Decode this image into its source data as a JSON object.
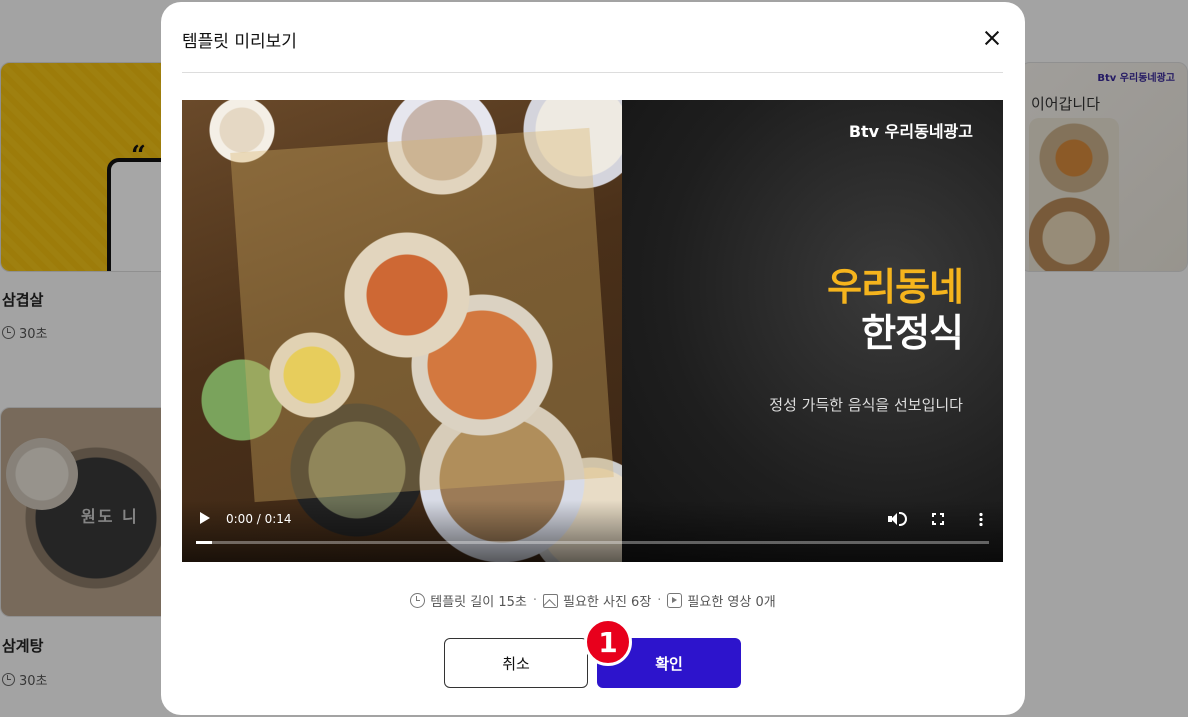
{
  "background": {
    "cards": [
      {
        "title": "삼겹살",
        "duration": "30초"
      },
      {
        "title": "삼계탕",
        "duration": "30초"
      }
    ],
    "right_card": {
      "brand": "Btv 우리동네광고",
      "text": "이어갑니다"
    },
    "soup_card_brand": "원도 니"
  },
  "modal": {
    "title": "템플릿 미리보기",
    "close_icon": "close-icon",
    "video": {
      "brand": "Btv 우리동네광고",
      "headline_line1": "우리동네",
      "headline_line2": "한정식",
      "subtitle": "정성 가득한 음식을 선보입니다",
      "time": "0:00 / 0:14",
      "progress": 0.02,
      "accent": "#f5b41d"
    },
    "meta": {
      "length": "템플릿 길이 15초",
      "photos": "필요한 사진 6장",
      "videos": "필요한 영상 0개",
      "separator": "·"
    },
    "buttons": {
      "cancel": "취소",
      "confirm": "확인",
      "confirm_color": "#2d14cc"
    },
    "step_badge": "1"
  }
}
